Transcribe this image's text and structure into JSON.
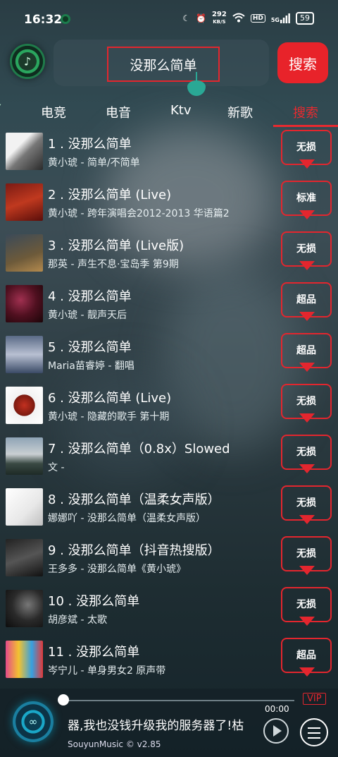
{
  "status": {
    "time": "16:32",
    "net_speed_value": "292",
    "net_speed_unit": "KB/S",
    "hd": "HD",
    "signal": "5G",
    "battery": "59"
  },
  "search": {
    "query": "没那么简单",
    "button_label": "搜索"
  },
  "tabs": [
    {
      "label": "电竞"
    },
    {
      "label": "电音"
    },
    {
      "label": "Ktv"
    },
    {
      "label": "新歌"
    },
    {
      "label": "搜索",
      "active": true
    }
  ],
  "results": [
    {
      "title": "1 . 没那么简单",
      "subtitle": "黄小琥 - 简单/不简单",
      "quality": "无损"
    },
    {
      "title": "2 . 没那么简单 (Live)",
      "subtitle": "黄小琥 - 跨年演唱会2012-2013 华语篇2",
      "quality": "标准"
    },
    {
      "title": "3 . 没那么简单 (Live版)",
      "subtitle": "那英 - 声生不息·宝岛季 第9期",
      "quality": "无损"
    },
    {
      "title": "4 . 没那么简单",
      "subtitle": "黄小琥 - 靓声天后",
      "quality": "超品"
    },
    {
      "title": "5 . 没那么简单",
      "subtitle": "Maria苗睿婷 - 翻唱",
      "quality": "超品"
    },
    {
      "title": "6 . 没那么简单 (Live)",
      "subtitle": "黄小琥 - 隐藏的歌手 第十期",
      "quality": "无损"
    },
    {
      "title": "7 . 没那么简单（0.8x）Slowed",
      "subtitle": "文 -",
      "quality": "无损"
    },
    {
      "title": "8 . 没那么简单（温柔女声版）",
      "subtitle": "娜娜吖 - 没那么简单（温柔女声版）",
      "quality": "无损"
    },
    {
      "title": "9 . 没那么简单（抖音热搜版）",
      "subtitle": "王多多 - 没那么简单《黄小琥》",
      "quality": "无损"
    },
    {
      "title": "10 . 没那么简单",
      "subtitle": "胡彦斌 - 太歌",
      "quality": "无损"
    },
    {
      "title": "11 . 没那么简单",
      "subtitle": "岑宁儿 - 单身男女2 原声带",
      "quality": "超品"
    }
  ],
  "player": {
    "vip": "VIP",
    "time": "00:00",
    "marquee": "器,我也没钱升级我的服务器了!枯",
    "version": "SouyunMusic © v2.85"
  },
  "colors": {
    "accent": "#e3262e"
  }
}
